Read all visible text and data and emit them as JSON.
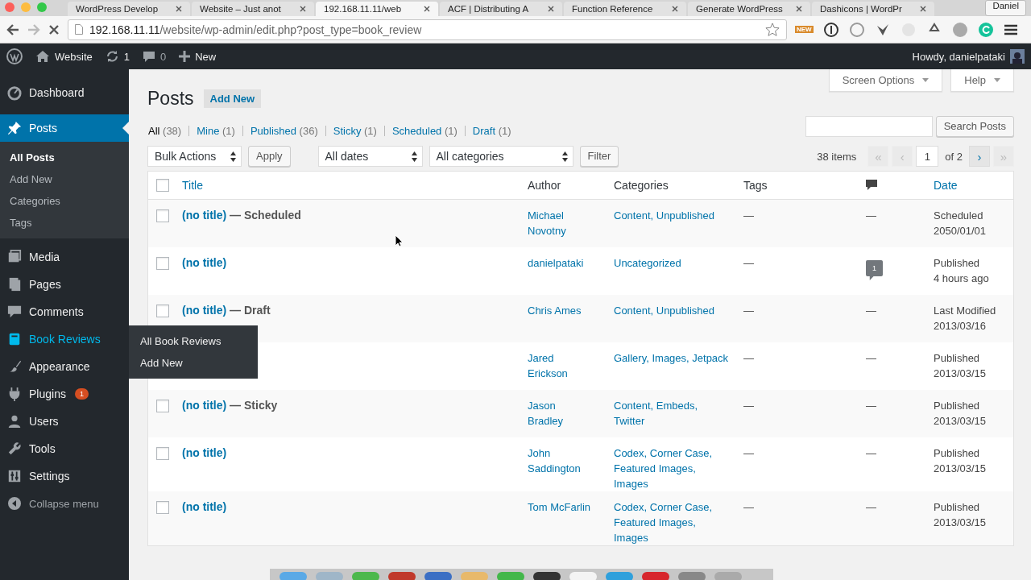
{
  "browser": {
    "tabs": [
      {
        "label": "WordPress Develop",
        "selected": false
      },
      {
        "label": "Website – Just anot",
        "selected": false
      },
      {
        "label": "192.168.11.11/web",
        "selected": true
      },
      {
        "label": "ACF | Distributing A",
        "selected": false
      },
      {
        "label": "Function Reference",
        "selected": false
      },
      {
        "label": "Generate WordPress",
        "selected": false
      },
      {
        "label": "Dashicons | WordPr",
        "selected": false
      }
    ],
    "profile": "Daniel",
    "url_host": "192.168.11.11",
    "url_path": "/website/wp-admin/edit.php?post_type=book_review",
    "extension_badge": "NEW"
  },
  "admin_bar": {
    "site": "Website",
    "updates": "1",
    "comments": "0",
    "new": "New",
    "greeting": "Howdy, danielpataki"
  },
  "sidebar": {
    "items": [
      {
        "label": "Dashboard",
        "selected": false,
        "hovered": false
      },
      {
        "label": "Posts",
        "selected": true,
        "hovered": false,
        "children": [
          {
            "label": "All Posts",
            "selected": true
          },
          {
            "label": "Add New",
            "selected": false
          },
          {
            "label": "Categories",
            "selected": false
          },
          {
            "label": "Tags",
            "selected": false
          }
        ]
      },
      {
        "label": "Media",
        "selected": false,
        "hovered": false
      },
      {
        "label": "Pages",
        "selected": false,
        "hovered": false
      },
      {
        "label": "Comments",
        "selected": false,
        "hovered": false
      },
      {
        "label": "Book Reviews",
        "selected": false,
        "hovered": true,
        "flyout": [
          "All Book Reviews",
          "Add New"
        ]
      },
      {
        "label": "Appearance",
        "selected": false,
        "hovered": false
      },
      {
        "label": "Plugins",
        "selected": false,
        "hovered": false,
        "badge": "1"
      },
      {
        "label": "Users",
        "selected": false,
        "hovered": false
      },
      {
        "label": "Tools",
        "selected": false,
        "hovered": false
      },
      {
        "label": "Settings",
        "selected": false,
        "hovered": false
      }
    ],
    "collapse": "Collapse menu"
  },
  "screen_meta": [
    "Screen Options",
    "Help"
  ],
  "page": {
    "title": "Posts",
    "add_new": "Add New"
  },
  "views": [
    {
      "label": "All",
      "count": "(38)",
      "selected": true
    },
    {
      "label": "Mine",
      "count": "(1)",
      "selected": false
    },
    {
      "label": "Published",
      "count": "(36)",
      "selected": false
    },
    {
      "label": "Sticky",
      "count": "(1)",
      "selected": false
    },
    {
      "label": "Scheduled",
      "count": "(1)",
      "selected": false
    },
    {
      "label": "Draft",
      "count": "(1)",
      "selected": false
    }
  ],
  "search": {
    "button": "Search Posts"
  },
  "filters": {
    "bulk": "Bulk Actions",
    "apply": "Apply",
    "dates": "All dates",
    "categories": "All categories",
    "filter": "Filter"
  },
  "pagination": {
    "items": "38 items",
    "current": "1",
    "total": "of 2",
    "first": {
      "label": "«",
      "disabled": true
    },
    "prev": {
      "label": "‹",
      "disabled": true
    },
    "next": {
      "label": "›",
      "disabled": false
    },
    "last": {
      "label": "»",
      "disabled": true
    }
  },
  "table": {
    "select_all_checked": false,
    "columns": [
      {
        "kind": "text",
        "label": "Title",
        "sortable": true
      },
      {
        "kind": "text",
        "label": "Author",
        "sortable": false
      },
      {
        "kind": "text",
        "label": "Categories",
        "sortable": false
      },
      {
        "kind": "text",
        "label": "Tags",
        "sortable": false
      },
      {
        "kind": "comments-icon"
      },
      {
        "kind": "text",
        "label": "Date",
        "sortable": true
      }
    ],
    "rows": [
      {
        "checked": false,
        "title": "(no title)",
        "state": "— Scheduled",
        "author": "Michael Novotny",
        "categories": "Content, Unpublished",
        "tags": "—",
        "comments": {
          "kind": "none",
          "text": "—"
        },
        "date_status": "Scheduled",
        "date": "2050/01/01"
      },
      {
        "checked": false,
        "title": "(no title)",
        "author": "danielpataki",
        "categories": "Uncategorized",
        "tags": "—",
        "comments": {
          "kind": "bubble",
          "text": "1"
        },
        "date_status": "Published",
        "date": "4 hours ago"
      },
      {
        "checked": false,
        "title": "(no title)",
        "state": "— Draft",
        "author": "Chris Ames",
        "categories": "Content, Unpublished",
        "tags": "—",
        "comments": {
          "kind": "none",
          "text": "—"
        },
        "date_status": "Last Modified",
        "date": "2013/03/16"
      },
      {
        "author": "Jared Erickson",
        "categories": "Gallery, Images, Jetpack",
        "tags": "—",
        "comments": {
          "kind": "none",
          "text": "—"
        },
        "date_status": "Published",
        "date": "2013/03/15"
      },
      {
        "checked": false,
        "title": "(no title)",
        "state": "— Sticky",
        "author": "Jason Bradley",
        "categories": "Content, Embeds, Twitter",
        "tags": "—",
        "comments": {
          "kind": "none",
          "text": "—"
        },
        "date_status": "Published",
        "date": "2013/03/15"
      },
      {
        "checked": false,
        "title": "(no title)",
        "author": "John Saddington",
        "categories": "Codex, Corner Case, Featured Images, Images",
        "tags": "—",
        "comments": {
          "kind": "none",
          "text": "—"
        },
        "date_status": "Published",
        "date": "2013/03/15"
      },
      {
        "checked": false,
        "title": "(no title)",
        "author": "Tom McFarlin",
        "categories": "Codex, Corner Case, Featured Images, Images",
        "tags": "—",
        "comments": {
          "kind": "none",
          "text": "—"
        },
        "date_status": "Published",
        "date": "2013/03/15"
      }
    ]
  }
}
